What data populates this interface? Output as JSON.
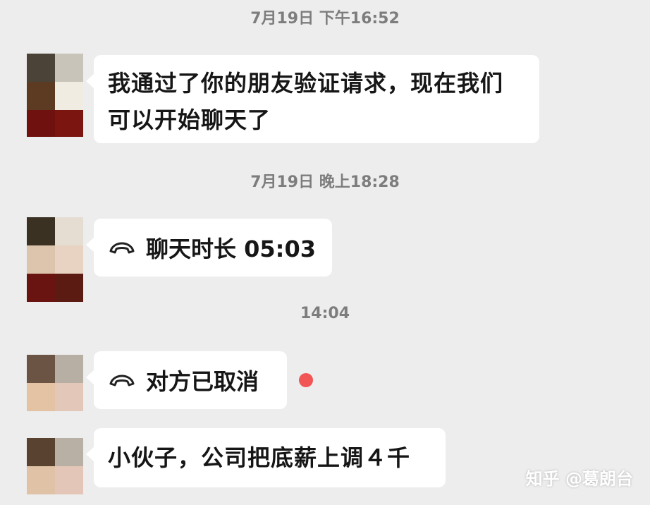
{
  "chat": {
    "timestamps": [
      "7月19日 下午16:52",
      "7月19日 晚上18:28",
      "14:04"
    ],
    "messages": [
      {
        "type": "text",
        "text_line1": "我通过了你的朋友验证请求，现在我们",
        "text_line2": "可以开始聊天了"
      },
      {
        "type": "call",
        "icon": "phone-hangup-icon",
        "text": "聊天时长 05:03"
      },
      {
        "type": "call",
        "icon": "phone-hangup-icon",
        "text": "对方已取消",
        "unread": true
      },
      {
        "type": "text",
        "text": "小伙子，公司把底薪上调４千"
      }
    ]
  },
  "watermark": "知乎 @葛朗台",
  "colors": {
    "background": "#ededed",
    "bubble": "#ffffff",
    "unread_dot": "#f25555",
    "timestamp": "#7d7d7d"
  }
}
